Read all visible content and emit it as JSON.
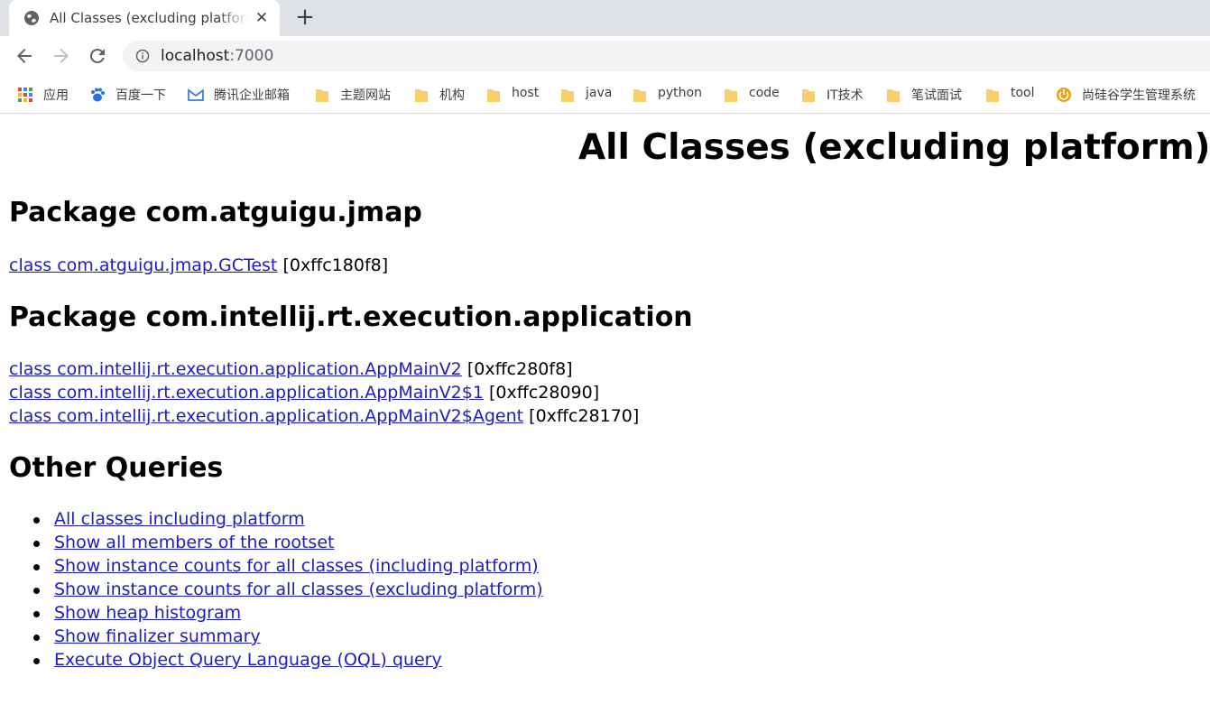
{
  "browser": {
    "tab": {
      "title": "All Classes (excluding platform)",
      "close_glyph": "✕",
      "favicon": "globe-icon"
    },
    "new_tab_glyph": "+",
    "toolbar": {
      "back": "back-arrow-icon",
      "forward": "forward-arrow-icon",
      "reload": "reload-icon",
      "url_host": "localhost",
      "url_port": ":7000"
    },
    "bookmarks": [
      {
        "label": "应用",
        "icon": "apps-grid-icon"
      },
      {
        "label": "百度一下",
        "icon": "baidu-paw-icon"
      },
      {
        "label": "腾讯企业邮箱",
        "icon": "tencent-mail-icon"
      },
      {
        "label": "主题网站",
        "icon": "folder-icon"
      },
      {
        "label": "机构",
        "icon": "folder-icon"
      },
      {
        "label": "host",
        "icon": "folder-icon"
      },
      {
        "label": "java",
        "icon": "folder-icon"
      },
      {
        "label": "python",
        "icon": "folder-icon"
      },
      {
        "label": "code",
        "icon": "folder-icon"
      },
      {
        "label": "IT技术",
        "icon": "folder-icon"
      },
      {
        "label": "笔试面试",
        "icon": "folder-icon"
      },
      {
        "label": "tool",
        "icon": "folder-icon"
      },
      {
        "label": "尚硅谷学生管理系统",
        "icon": "power-logo-icon"
      }
    ],
    "colors": {
      "tabstrip": "#dee1e6",
      "omnibox": "#f1f3f4",
      "link": "#1c1cc4",
      "folder": "#f8d06a"
    }
  },
  "page": {
    "title": "All Classes (excluding platform)",
    "packages": [
      {
        "heading": "Package com.atguigu.jmap",
        "classes": [
          {
            "link": "class com.atguigu.jmap.GCTest",
            "address": "[0xffc180f8]"
          }
        ]
      },
      {
        "heading": "Package com.intellij.rt.execution.application",
        "classes": [
          {
            "link": "class com.intellij.rt.execution.application.AppMainV2",
            "address": "[0xffc280f8]"
          },
          {
            "link": "class com.intellij.rt.execution.application.AppMainV2$1",
            "address": "[0xffc28090]"
          },
          {
            "link": "class com.intellij.rt.execution.application.AppMainV2$Agent",
            "address": "[0xffc28170]"
          }
        ]
      }
    ],
    "other_queries": {
      "heading": "Other Queries",
      "items": [
        "All classes including platform",
        "Show all members of the rootset",
        "Show instance counts for all classes (including platform)",
        "Show instance counts for all classes (excluding platform)",
        "Show heap histogram",
        "Show finalizer summary",
        "Execute Object Query Language (OQL) query"
      ]
    }
  }
}
